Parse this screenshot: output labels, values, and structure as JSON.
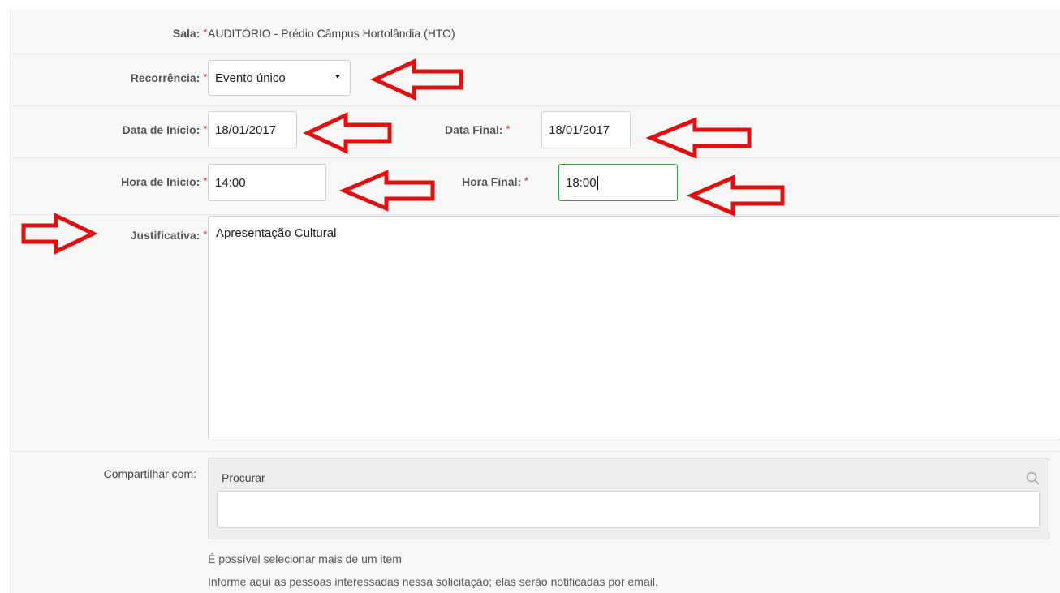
{
  "form": {
    "sala": {
      "label": "Sala:",
      "required": "*",
      "value": "AUDITÓRIO - Prédio Câmpus Hortolândia (HTO)"
    },
    "recorrencia": {
      "label": "Recorrência:",
      "required": "*",
      "value": "Evento único"
    },
    "data_inicio": {
      "label": "Data de Início:",
      "required": "*",
      "value": "18/01/2017"
    },
    "data_final": {
      "label": "Data Final:",
      "required": "*",
      "value": "18/01/2017"
    },
    "hora_inicio": {
      "label": "Hora de Início:",
      "required": "*",
      "value": "14:00"
    },
    "hora_final": {
      "label": "Hora Final:",
      "required": "*",
      "value": "18:00"
    },
    "justificativa": {
      "label": "Justificativa:",
      "required": "*",
      "value": "Apresentação Cultural"
    },
    "compartilhar": {
      "label": "Compartilhar com:",
      "search_placeholder": "Procurar",
      "help_1": "É possível selecionar mais de um item",
      "help_2": "Informe aqui as pessoas interessadas nessa solicitação; elas serão notificadas por email."
    }
  },
  "annotations": {
    "arrow_color": "#e01010"
  },
  "icons": {
    "search": "search-icon",
    "select_arrow": "triangle-down-icon"
  }
}
